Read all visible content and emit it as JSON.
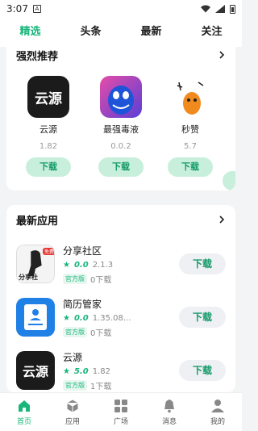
{
  "status_bar": {
    "time": "3:07",
    "notif_letter": "A"
  },
  "top_tabs": [
    {
      "label": "精选",
      "active": true
    },
    {
      "label": "头条",
      "active": false
    },
    {
      "label": "最新",
      "active": false
    },
    {
      "label": "关注",
      "active": false
    }
  ],
  "featured": {
    "title": "强烈推荐",
    "apps": [
      {
        "name": "云源",
        "version": "1.82",
        "button": "下载",
        "icon": "yunyuan-icon"
      },
      {
        "name": "最强毒液",
        "version": "0.0.2",
        "button": "下载",
        "icon": "venom-icon"
      },
      {
        "name": "秒赞",
        "version": "5.7",
        "button": "下载",
        "icon": "miaozan-icon"
      }
    ]
  },
  "latest": {
    "title": "最新应用",
    "items": [
      {
        "name": "分享社区",
        "score": "0.0",
        "version": "2.1.3",
        "tag": "官方版",
        "downloads": "0下载",
        "button": "下载",
        "icon_text": "分享社",
        "badge": "免费"
      },
      {
        "name": "简历管家",
        "score": "0.0",
        "version": "1.35.08...",
        "tag": "官方版",
        "downloads": "0下载",
        "button": "下载"
      },
      {
        "name": "云源",
        "score": "5.0",
        "version": "1.82",
        "tag": "官方版",
        "downloads": "1下载",
        "button": "下载",
        "icon_text": "云源"
      }
    ]
  },
  "bottom_nav": [
    {
      "label": "首页",
      "icon": "home-icon",
      "active": true
    },
    {
      "label": "应用",
      "icon": "box-icon",
      "active": false
    },
    {
      "label": "广场",
      "icon": "grid-icon",
      "active": false
    },
    {
      "label": "消息",
      "icon": "bell-icon",
      "active": false
    },
    {
      "label": "我的",
      "icon": "person-icon",
      "active": false
    }
  ],
  "colors": {
    "accent": "#19b67c",
    "button_bg": "#c8efdc",
    "page_bg": "#f3f4f6"
  }
}
